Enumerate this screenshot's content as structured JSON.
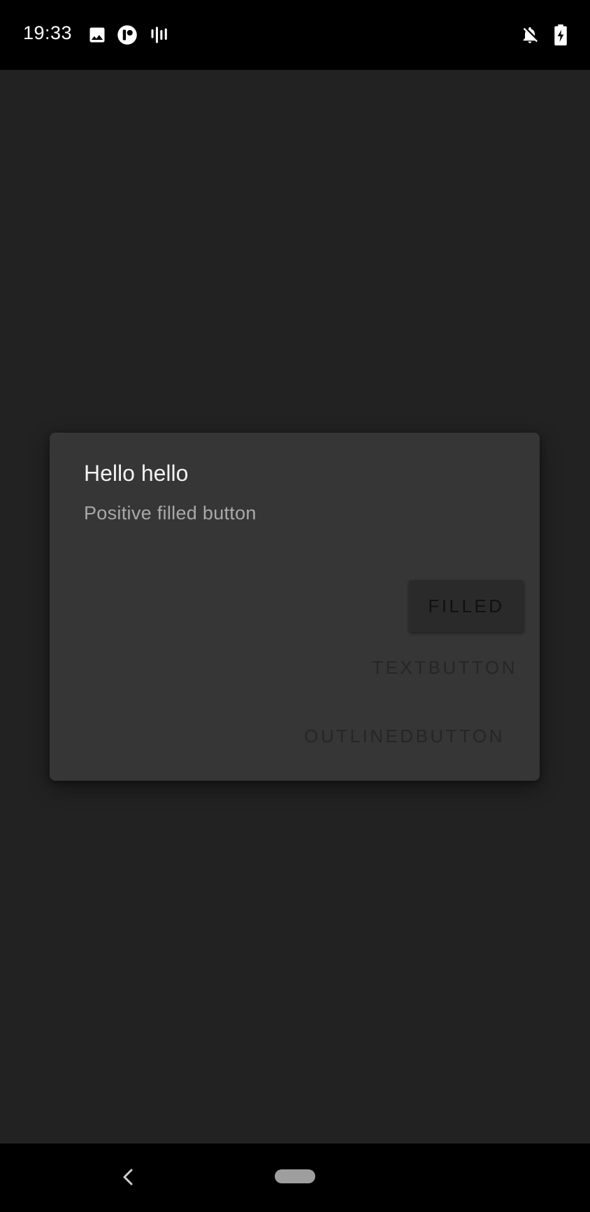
{
  "status_bar": {
    "time": "19:33",
    "icons_left": [
      "image-icon",
      "app-icon",
      "sound-bars-icon"
    ],
    "icons_right": [
      "notifications-off-icon",
      "battery-charging-icon"
    ]
  },
  "dialog": {
    "title": "Hello hello",
    "message": "Positive filled button",
    "buttons": {
      "filled": "FILLED",
      "text": "TEXTBUTTON",
      "outlined": "OUTLINEDBUTTON"
    }
  },
  "nav_bar": {
    "icons": [
      "back-icon",
      "home-pill-icon"
    ]
  },
  "colors": {
    "background": "#222222",
    "dialog_surface": "#363636",
    "status_bar": "#000000",
    "title_text": "#f2f2f2",
    "message_text": "#a9a9a9",
    "filled_button_bg": "#2a2a2a",
    "button_text": "#262626"
  }
}
